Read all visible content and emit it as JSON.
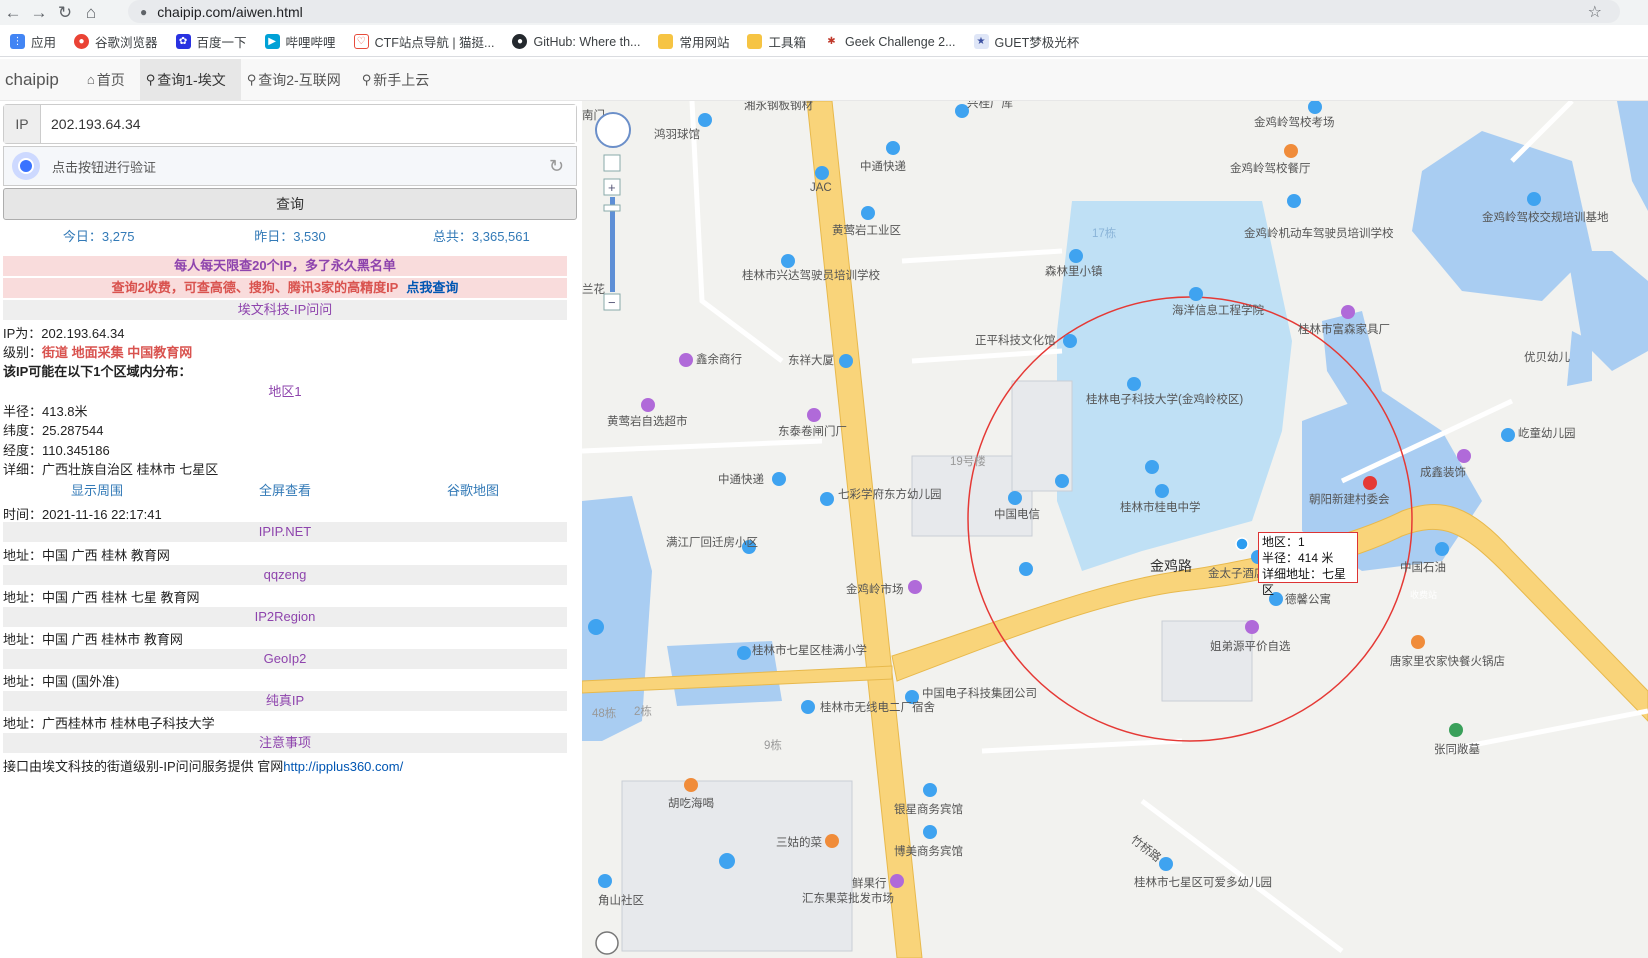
{
  "browser": {
    "url": "chaipip.com/aiwen.html",
    "bookmarks": [
      "应用",
      "谷歌浏览器",
      "百度一下",
      "哔哩哔哩",
      "CTF站点导航 | 猫挺...",
      "GitHub: Where th...",
      "常用网站",
      "工具箱",
      "Geek Challenge 2...",
      "GUET梦极光杯"
    ]
  },
  "nav": {
    "brand": "chaipip",
    "items": [
      "首页",
      "查询1-埃文",
      "查询2-互联网",
      "新手上云"
    ]
  },
  "form": {
    "ip_label": "IP",
    "ip_value": "202.193.64.34",
    "captcha_text": "点击按钮进行验证",
    "query_button": "查询"
  },
  "stats": {
    "today": "今日：3,275",
    "yesterday": "昨日：3,530",
    "total": "总共：3,365,561"
  },
  "notices": {
    "limit": "每人每天限查20个IP，多了永久黑名单",
    "paid": "查询2收费，可查高德、搜狗、腾讯3家的高精度IP",
    "paid_link": "点我查询"
  },
  "aiwen": {
    "header": "埃文科技-IP问问",
    "ip_line": "IP为：202.193.64.34",
    "level_label": "级别：",
    "level_tags": "街道 地面采集 中国教育网",
    "possible": "该IP可能在以下1个区域内分布：",
    "region_title": "地区1",
    "radius": "半径：413.8米",
    "lat": "纬度：25.287544",
    "lng": "经度：110.345186",
    "detail": "详细：广西壮族自治区 桂林市 七星区",
    "links": [
      "显示周围",
      "全屏查看",
      "谷歌地图"
    ],
    "time": "时间：2021-11-16 22:17:41"
  },
  "sources": [
    {
      "name": "IPIP.NET",
      "addr": "地址：中国 广西 桂林 教育网"
    },
    {
      "name": "qqzeng",
      "addr": "地址：中国 广西 桂林 七星 教育网"
    },
    {
      "name": "IP2Region",
      "addr": "地址：中国 广西 桂林市 教育网"
    },
    {
      "name": "GeoIp2",
      "addr": "地址：中国 (国外准)"
    },
    {
      "name": "纯真IP",
      "addr": "地址：广西桂林市 桂林电子科技大学"
    }
  ],
  "notes": {
    "header": "注意事项",
    "text": "接口由埃文科技的街道级别-IP问问服务提供 官网",
    "link": "http://ipplus360.com/"
  },
  "map": {
    "tooltip": {
      "line1": "地区：1",
      "line2": "半径：414 米",
      "line3": "详细地址：七星区"
    },
    "road_label": "金鸡路",
    "labels": [
      "湘永钢板钢材",
      "兴桂厂库",
      "金鸡岭驾校考场",
      "鸿羽球馆",
      "中通快递",
      "JAC",
      "金鸡岭驾校餐厅",
      "金鸡岭驾校交规培训基地",
      "黄莺岩工业区",
      "金鸡岭机动车驾驶员培训学校",
      "17栋",
      "桂林市兴达驾驶员培训学校",
      "森林里小镇",
      "海洋信息工程学院",
      "桂林市富森家具厂",
      "优贝幼儿",
      "正平科技文化馆",
      "东祥大厦",
      "鑫余商行",
      "桂林电子科技大学(金鸡岭校区)",
      "黄莺岩自选超市",
      "东泰卷闸门厂",
      "屹童幼儿园",
      "成鑫装饰",
      "19号楼",
      "中通快递",
      "七彩学府东方幼儿园",
      "桂林市桂电中学",
      "朝阳新建村委会",
      "中国电信",
      "满江厂回迁房小区",
      "金太子酒店",
      "中国石油",
      "收费站",
      "金鸡岭市场",
      "德馨公寓",
      "姐弟源平价自选",
      "桂林市七星区桂满小学",
      "唐家里农家快餐火锅店",
      "中国电子科技集团公司",
      "桂林市无线电二厂宿舍",
      "48栋",
      "2栋",
      "9栋",
      "张同敞墓",
      "胡吃海喝",
      "银星商务宾馆",
      "三姑的菜",
      "博美商务宾馆",
      "竹桥路",
      "鲜果行",
      "汇东果菜批发市场",
      "桂林市七星区可爱多幼儿园",
      "角山社区",
      "南门",
      "兰花"
    ]
  },
  "colors": {
    "accent": "#337ab7",
    "purple": "#8e44ad",
    "tag_red": "#d9534f",
    "pink_bg": "#f9dcdc",
    "map_bg": "#f2f2ef",
    "campus": "#bfe0f5",
    "water": "#a9cdf2",
    "road": "#f9d47a",
    "circle": "#e53935"
  }
}
